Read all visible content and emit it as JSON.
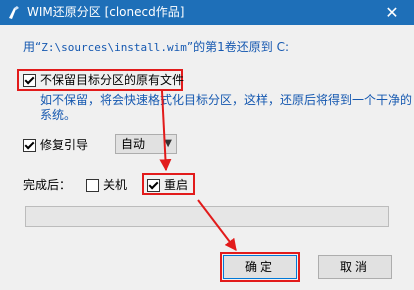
{
  "window": {
    "title": "WIM还原分区 [clonecd作品]",
    "app_icon": "tool-icon",
    "close_icon": "close-icon",
    "close_glyph": "✕"
  },
  "info": {
    "prefix": "用“",
    "path": "Z:\\sources\\install.wim",
    "suffix": "”的第1卷还原到 C:"
  },
  "options": {
    "keep_files": {
      "label": "不保留目标分区的原有文件",
      "checked": true
    },
    "keep_files_desc": "如不保留，将会快速格式化目标分区，这样，还原后将得到一个干净的系统。",
    "repair_boot": {
      "label": "修复引导",
      "checked": true
    },
    "repair_mode": {
      "selected": "自动"
    }
  },
  "after_complete": {
    "label": "完成后：",
    "shutdown": {
      "label": "关机",
      "checked": false
    },
    "restart": {
      "label": "重启",
      "checked": true
    }
  },
  "progress": {
    "percent": 0
  },
  "buttons": {
    "ok": "确定",
    "cancel": "取消"
  },
  "colors": {
    "titlebar": "#1e6fb8",
    "info_text": "#1558b0",
    "highlight": "#e21b1b"
  }
}
